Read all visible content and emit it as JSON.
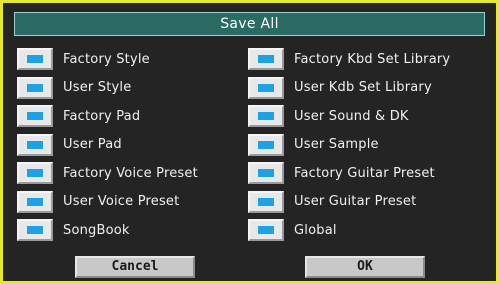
{
  "dialog": {
    "title": "Save All",
    "left_items": [
      {
        "label": "Factory Style",
        "checked": true
      },
      {
        "label": "User Style",
        "checked": true
      },
      {
        "label": "Factory Pad",
        "checked": true
      },
      {
        "label": "User Pad",
        "checked": true
      },
      {
        "label": "Factory Voice Preset",
        "checked": true
      },
      {
        "label": "User Voice Preset",
        "checked": true
      },
      {
        "label": "SongBook",
        "checked": true
      }
    ],
    "right_items": [
      {
        "label": "Factory Kbd Set Library",
        "checked": true
      },
      {
        "label": "User Kdb Set Library",
        "checked": true
      },
      {
        "label": "User Sound & DK",
        "checked": true
      },
      {
        "label": "User Sample",
        "checked": true
      },
      {
        "label": "Factory Guitar Preset",
        "checked": true
      },
      {
        "label": "User Guitar Preset",
        "checked": true
      },
      {
        "label": "Global",
        "checked": true
      }
    ],
    "cancel_label": "Cancel",
    "ok_label": "OK"
  },
  "colors": {
    "frame": "#e4ea24",
    "title_bg": "#2a6b64",
    "check_mark": "#1aa3e6",
    "background": "#242424"
  }
}
